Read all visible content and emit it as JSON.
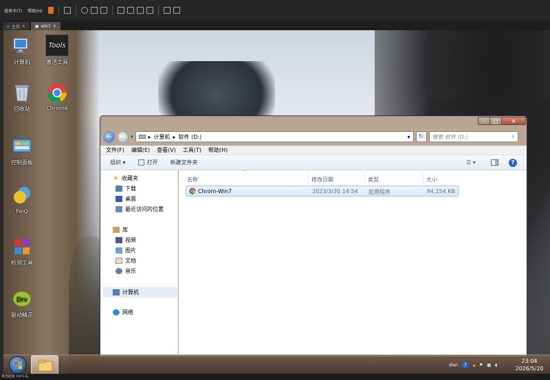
{
  "host": {
    "menu": [
      "选项卡(T)",
      "帮助(H)"
    ],
    "tabs": [
      {
        "label": "主页"
      },
      {
        "label": "win7"
      }
    ],
    "status": "单击此处 Ctrl+G。"
  },
  "desktop": {
    "icons": [
      {
        "label": "计算机"
      },
      {
        "label": "激活工具",
        "overlay": "Tools"
      },
      {
        "label": "回收站"
      },
      {
        "label": "Chrome"
      },
      {
        "label": "控制面板"
      },
      {
        "label": "FeiQ"
      },
      {
        "label": "检测工具"
      },
      {
        "label": "驱动精灵"
      }
    ]
  },
  "explorer": {
    "nav": {
      "path": [
        "计算机",
        "软件 (D:)"
      ],
      "search_placeholder": "搜索 软件 (D:)"
    },
    "menu": [
      "文件(F)",
      "编辑(E)",
      "查看(V)",
      "工具(T)",
      "帮助(H)"
    ],
    "commands": {
      "organize": "组织 ▾",
      "open": "打开",
      "new_folder": "新建文件夹"
    },
    "sidebar": {
      "favorites": {
        "label": "收藏夹",
        "items": [
          "下载",
          "桌面",
          "最近访问的位置"
        ]
      },
      "libraries": {
        "label": "库",
        "items": [
          "视频",
          "图片",
          "文档",
          "音乐"
        ]
      },
      "computer": "计算机",
      "network": "网络"
    },
    "columns": [
      "名称",
      "修改日期",
      "类型",
      "大小"
    ],
    "files": [
      {
        "name": "Chrom-Win7",
        "modified": "2023/3/20 14:54",
        "type": "应用程序",
        "size": "84,154 KB"
      }
    ]
  },
  "taskbar": {
    "tray_lang": "dian",
    "time": "23:04",
    "date": "2026/5/20"
  },
  "colors": {
    "accent": "#3a6fc4",
    "selection": "#d9e9fa",
    "chrome_red": "#db4437",
    "chrome_yellow": "#f4b400",
    "chrome_green": "#0f9d58"
  }
}
